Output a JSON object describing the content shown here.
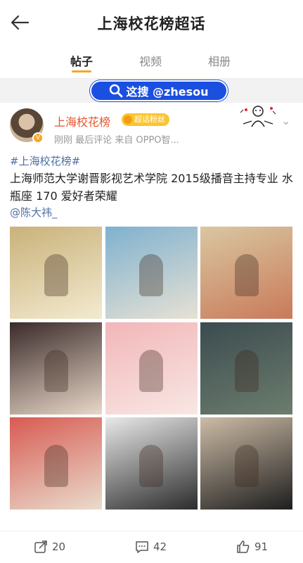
{
  "header": {
    "title": "上海校花榜超话"
  },
  "tabs": [
    {
      "label": "帖子",
      "active": true
    },
    {
      "label": "视频",
      "active": false
    },
    {
      "label": "相册",
      "active": false
    }
  ],
  "watermark": {
    "text": "这搜 @zhesou",
    "color": "#1b4fe0"
  },
  "post": {
    "username": "上海校花榜",
    "badge": "超话粉丝",
    "meta": "刚刚  最后评论   来自 OPPO智...",
    "hashtag": "#上海校花榜#",
    "text": "上海师范大学谢晋影视艺术学院 2015级播音主持专业 水瓶座 170 爱好者荣耀",
    "mention": "@陈大祎_",
    "photos": [
      {
        "name": "photo-ball-pit",
        "colors": [
          "#c9b27a",
          "#f3ead0"
        ]
      },
      {
        "name": "photo-pool",
        "colors": [
          "#7fb1cf",
          "#e7e1d4"
        ]
      },
      {
        "name": "photo-straw-hat",
        "colors": [
          "#d9c7a1",
          "#c97a5a"
        ]
      },
      {
        "name": "photo-lights",
        "colors": [
          "#3a2a2a",
          "#e8d8c8"
        ]
      },
      {
        "name": "photo-pink-wall",
        "colors": [
          "#f2b6b8",
          "#f8e7e4"
        ]
      },
      {
        "name": "photo-cityscape",
        "colors": [
          "#3c4b4f",
          "#6c7d6e"
        ]
      },
      {
        "name": "photo-red-wall",
        "colors": [
          "#d85b52",
          "#e9dccd"
        ]
      },
      {
        "name": "photo-dog-collage",
        "colors": [
          "#e9e9ea",
          "#2c2c2c"
        ]
      },
      {
        "name": "photo-floral",
        "colors": [
          "#cdbca6",
          "#1e1e1e"
        ]
      }
    ]
  },
  "actions": {
    "repost_count": "20",
    "comment_count": "42",
    "like_count": "91"
  }
}
